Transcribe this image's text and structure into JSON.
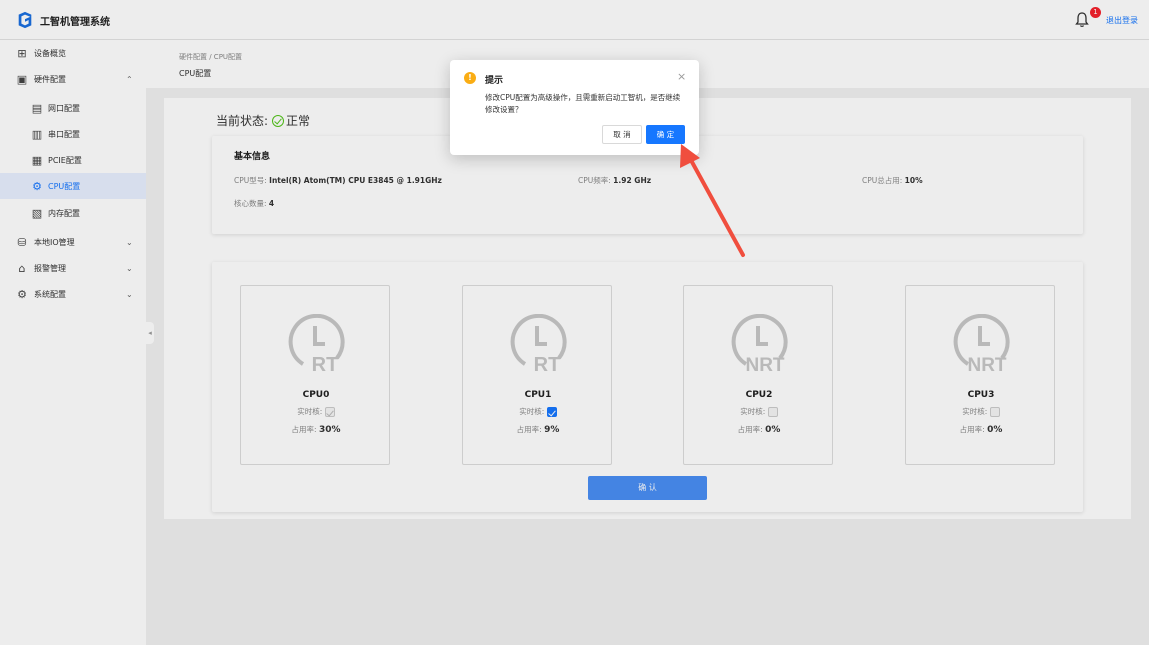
{
  "header": {
    "app_title": "工智机管理系统",
    "notification_count": "1",
    "logout_label": "退出登录"
  },
  "sidebar": {
    "items": [
      {
        "label": "设备概览",
        "icon": "dashboard-icon"
      },
      {
        "label": "硬件配置",
        "icon": "hardware-icon",
        "expanded": true
      },
      {
        "label": "网口配置",
        "icon": "network-port-icon"
      },
      {
        "label": "串口配置",
        "icon": "serial-port-icon"
      },
      {
        "label": "PCIE配置",
        "icon": "pcie-icon"
      },
      {
        "label": "CPU配置",
        "icon": "cpu-icon",
        "active": true
      },
      {
        "label": "内存配置",
        "icon": "memory-icon"
      },
      {
        "label": "本地IO管理",
        "icon": "io-icon"
      },
      {
        "label": "报警管理",
        "icon": "alarm-icon"
      },
      {
        "label": "系统配置",
        "icon": "settings-icon"
      }
    ]
  },
  "breadcrumb": "硬件配置 / CPU配置",
  "page_title": "CPU配置",
  "status": {
    "label": "当前状态:",
    "value": "正常",
    "color": "#52c41a"
  },
  "basic_info": {
    "title": "基本信息",
    "cpu_model_label": "CPU型号:",
    "cpu_model": "Intel(R) Atom(TM) CPU E3845 @ 1.91GHz",
    "cpu_freq_label": "CPU频率:",
    "cpu_freq": "1.92 GHz",
    "cpu_usage_label": "CPU总占用:",
    "cpu_usage": "10%",
    "core_count_label": "核心数量:",
    "core_count": "4"
  },
  "cpus": [
    {
      "name": "CPU0",
      "mode": "RT",
      "realtime_label": "实时核:",
      "realtime": "disabled-checked",
      "usage_label": "占用率:",
      "usage": "30%"
    },
    {
      "name": "CPU1",
      "mode": "RT",
      "realtime_label": "实时核:",
      "realtime": "checked",
      "usage_label": "占用率:",
      "usage": "9%"
    },
    {
      "name": "CPU2",
      "mode": "NRT",
      "realtime_label": "实时核:",
      "realtime": "unchecked",
      "usage_label": "占用率:",
      "usage": "0%"
    },
    {
      "name": "CPU3",
      "mode": "NRT",
      "realtime_label": "实时核:",
      "realtime": "unchecked",
      "usage_label": "占用率:",
      "usage": "0%"
    }
  ],
  "confirm_label": "确 认",
  "dialog": {
    "title": "提示",
    "message": "修改CPU配置为高级操作，且需重新启动工智机，是否继续修改设置？",
    "cancel_label": "取 消",
    "ok_label": "确 定"
  },
  "colors": {
    "primary": "#1677ff",
    "warning": "#faad14",
    "arrow": "#f04e3e"
  }
}
